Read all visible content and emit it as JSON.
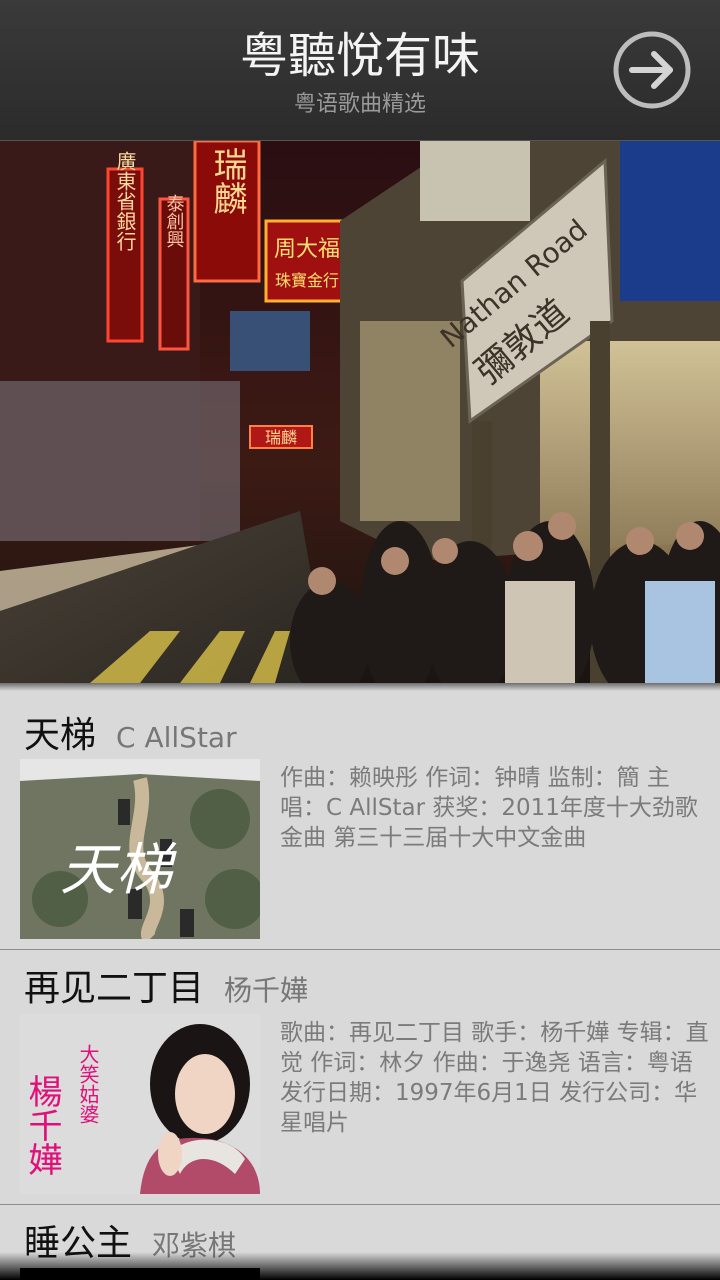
{
  "header": {
    "title": "粤聽悅有味",
    "subtitle": "粤语歌曲精选"
  },
  "banner": {
    "signs": [
      "瑞麟",
      "廣東省銀行",
      "泰創興",
      "周大福",
      "珠寶金行",
      "Nathan Road",
      "彌敦道",
      "瑞麟"
    ]
  },
  "songs": [
    {
      "title": "天梯",
      "artist": "C AllStar",
      "description": "作曲：赖映彤 作词：钟晴 监制：簡 主唱：C AllStar 获奖：2011年度十大劲歌金曲 第三十三届十大中文金曲",
      "cover_text": "天梯"
    },
    {
      "title": "再见二丁目",
      "artist": "杨千嬅",
      "description": "歌曲：再见二丁目 歌手：杨千嬅 专辑：直觉 作词：林夕 作曲：于逸尧 语言：粤语 发行日期：1997年6月1日 发行公司：华星唱片",
      "cover_text": "楊千嬅",
      "cover_subtext": "大笑姑婆"
    },
    {
      "title": "睡公主",
      "artist": "邓紫棋"
    }
  ]
}
